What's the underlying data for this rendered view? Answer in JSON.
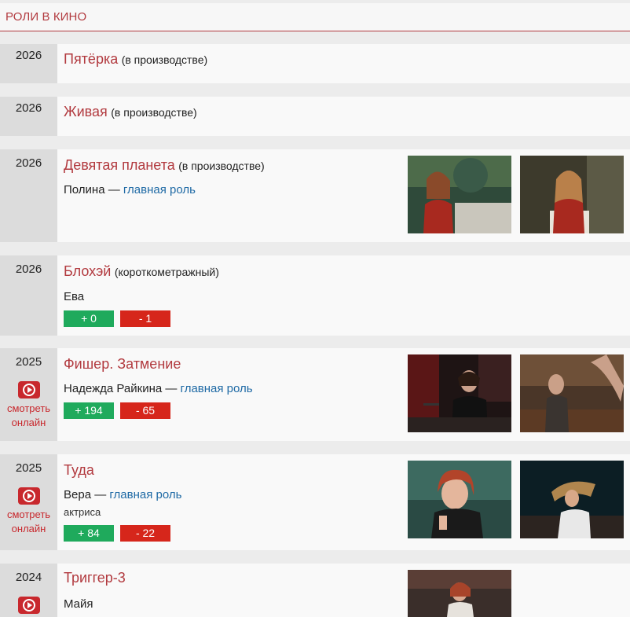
{
  "section": {
    "title": "РОЛИ В КИНО"
  },
  "watch_label_1": "смотреть",
  "watch_label_2": "онлайн",
  "films": [
    {
      "year": "2026",
      "title": "Пятёрка",
      "note": "(в производстве)"
    },
    {
      "year": "2026",
      "title": "Живая",
      "note": "(в производстве)"
    },
    {
      "year": "2026",
      "title": "Девятая планета",
      "note": "(в производстве)",
      "role": "Полина",
      "role_sep": " — ",
      "role_type": "главная роль"
    },
    {
      "year": "2026",
      "title": "Блохэй",
      "note": "(короткометражный)",
      "role": "Ева",
      "plus": "+ 0",
      "minus": "- 1"
    },
    {
      "year": "2025",
      "title": "Фишер. Затмение",
      "note": "",
      "role": "Надежда Райкина",
      "role_sep": " — ",
      "role_type": "главная роль",
      "plus": "+ 194",
      "minus": "- 65"
    },
    {
      "year": "2025",
      "title": "Туда",
      "note": "",
      "role": "Вера",
      "role_sep": " — ",
      "role_type": "главная роль",
      "profession": "актриса",
      "plus": "+ 84",
      "minus": "- 22"
    },
    {
      "year": "2024",
      "title": "Триггер-3",
      "note": "",
      "role": "Майя"
    }
  ],
  "colors": {
    "accent": "#b23a3f",
    "link": "#1f6aa5",
    "plus": "#1faa5c",
    "minus": "#d6261b",
    "watch": "#c8282d"
  }
}
